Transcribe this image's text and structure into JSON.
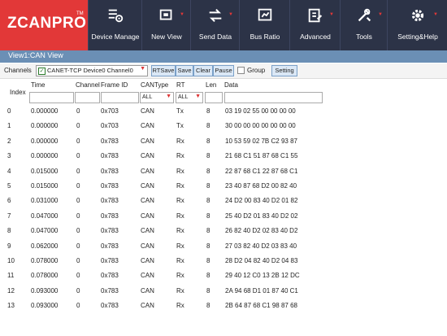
{
  "brand": {
    "name": "ZCANPRO",
    "tm": "TM",
    "logo_color": "#e23838",
    "ribbon_bg": "#2c3347"
  },
  "ribbon": [
    {
      "label": "Device Manage",
      "icon": "device-manage-icon",
      "dropdown": false
    },
    {
      "label": "New View",
      "icon": "new-view-icon",
      "dropdown": true
    },
    {
      "label": "Send Data",
      "icon": "send-data-icon",
      "dropdown": true
    },
    {
      "label": "Bus Ratio",
      "icon": "bus-ratio-icon",
      "dropdown": false
    },
    {
      "label": "Advanced",
      "icon": "advanced-icon",
      "dropdown": true
    },
    {
      "label": "Tools",
      "icon": "tools-icon",
      "dropdown": true
    },
    {
      "label": "Setting&Help",
      "icon": "settings-help-icon",
      "dropdown": true
    }
  ],
  "view": {
    "title": "View1:CAN View"
  },
  "toolbar": {
    "channels_label": "Channels",
    "channel_value": "CANET-TCP Device0 Channel0",
    "rtsave": "RTSave",
    "save": "Save",
    "clear": "Clear",
    "pause": "Pause",
    "group": "Group",
    "setting": "Setting"
  },
  "table": {
    "headers": {
      "index": "Index",
      "time": "Time",
      "channel": "Channel",
      "frame_id": "Frame ID",
      "cantype": "CANType",
      "rt": "RT",
      "len": "Len",
      "data": "Data"
    },
    "filters": {
      "cantype": "ALL",
      "rt": "ALL"
    },
    "rows": [
      {
        "index": "0",
        "time": "0.000000",
        "channel": "0",
        "frame_id": "0x703",
        "cantype": "CAN",
        "rt": "Tx",
        "len": "8",
        "data": "03 19 02 55 00 00 00 00"
      },
      {
        "index": "1",
        "time": "0.000000",
        "channel": "0",
        "frame_id": "0x703",
        "cantype": "CAN",
        "rt": "Tx",
        "len": "8",
        "data": "30 00 00 00 00 00 00 00"
      },
      {
        "index": "2",
        "time": "0.000000",
        "channel": "0",
        "frame_id": "0x783",
        "cantype": "CAN",
        "rt": "Rx",
        "len": "8",
        "data": "10 53 59 02 7B C2 93 87"
      },
      {
        "index": "3",
        "time": "0.000000",
        "channel": "0",
        "frame_id": "0x783",
        "cantype": "CAN",
        "rt": "Rx",
        "len": "8",
        "data": "21 68 C1 51 87 68 C1 55"
      },
      {
        "index": "4",
        "time": "0.015000",
        "channel": "0",
        "frame_id": "0x783",
        "cantype": "CAN",
        "rt": "Rx",
        "len": "8",
        "data": "22 87 68 C1 22 87 68 C1"
      },
      {
        "index": "5",
        "time": "0.015000",
        "channel": "0",
        "frame_id": "0x783",
        "cantype": "CAN",
        "rt": "Rx",
        "len": "8",
        "data": "23 40 87 68 D2 00 82 40"
      },
      {
        "index": "6",
        "time": "0.031000",
        "channel": "0",
        "frame_id": "0x783",
        "cantype": "CAN",
        "rt": "Rx",
        "len": "8",
        "data": "24 D2 00 83 40 D2 01 82"
      },
      {
        "index": "7",
        "time": "0.047000",
        "channel": "0",
        "frame_id": "0x783",
        "cantype": "CAN",
        "rt": "Rx",
        "len": "8",
        "data": "25 40 D2 01 83 40 D2 02"
      },
      {
        "index": "8",
        "time": "0.047000",
        "channel": "0",
        "frame_id": "0x783",
        "cantype": "CAN",
        "rt": "Rx",
        "len": "8",
        "data": "26 82 40 D2 02 83 40 D2"
      },
      {
        "index": "9",
        "time": "0.062000",
        "channel": "0",
        "frame_id": "0x783",
        "cantype": "CAN",
        "rt": "Rx",
        "len": "8",
        "data": "27 03 82 40 D2 03 83 40"
      },
      {
        "index": "10",
        "time": "0.078000",
        "channel": "0",
        "frame_id": "0x783",
        "cantype": "CAN",
        "rt": "Rx",
        "len": "8",
        "data": "28 D2 04 82 40 D2 04 83"
      },
      {
        "index": "11",
        "time": "0.078000",
        "channel": "0",
        "frame_id": "0x783",
        "cantype": "CAN",
        "rt": "Rx",
        "len": "8",
        "data": "29 40 12 C0 13 2B 12 DC"
      },
      {
        "index": "12",
        "time": "0.093000",
        "channel": "0",
        "frame_id": "0x783",
        "cantype": "CAN",
        "rt": "Rx",
        "len": "8",
        "data": "2A 94 68 D1 01 87 40 C1"
      },
      {
        "index": "13",
        "time": "0.093000",
        "channel": "0",
        "frame_id": "0x783",
        "cantype": "CAN",
        "rt": "Rx",
        "len": "8",
        "data": "2B 64 87 68 C1 98 87 68"
      }
    ]
  }
}
